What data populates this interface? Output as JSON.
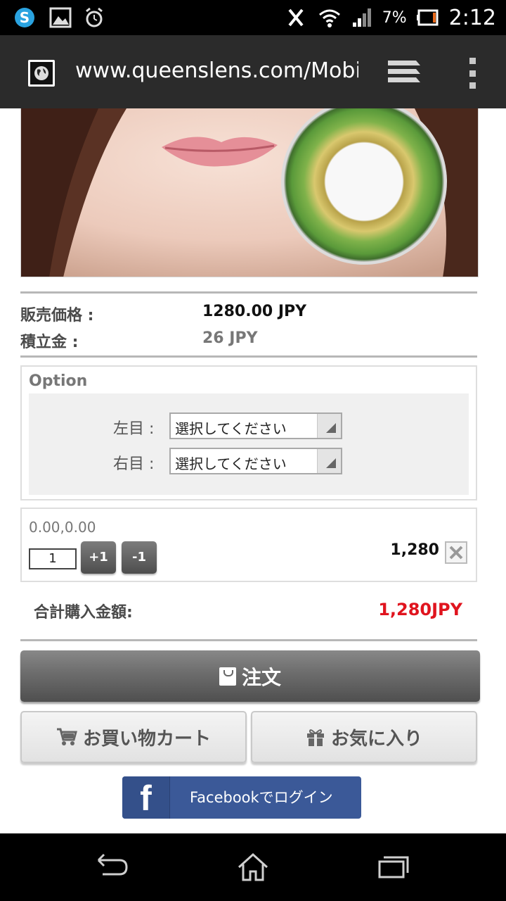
{
  "status_bar": {
    "left_icons": [
      "skype-icon",
      "gallery-icon",
      "alarm-icon"
    ],
    "right_icons": [
      "vibrate-icon",
      "wifi-icon",
      "signal-icon",
      "battery-icon"
    ],
    "battery_pct": "7%",
    "time": "2:12"
  },
  "browser": {
    "url": "www.queenslens.com/Mobile/",
    "favicon": "globe-icon",
    "tabs_icon": "tabs-icon",
    "menu_icon": "overflow-menu-icon"
  },
  "product": {
    "price_label": "販売価格 :",
    "price_value": "1280.00 JPY",
    "points_label": "積立金 :",
    "points_value": "26 JPY"
  },
  "option": {
    "title": "Option",
    "left_label": "左目 :",
    "left_value": "選択してください",
    "right_label": "右目 :",
    "right_value": "選択してください"
  },
  "quantity": {
    "selected_option": "0.00,0.00",
    "qty": "1",
    "plus_label": "+1",
    "minus_label": "-1",
    "line_price": "1,280"
  },
  "total": {
    "label": "合計購入金額:",
    "value": "1,280JPY"
  },
  "buttons": {
    "order": "注文",
    "cart": "お買い物カート",
    "wishlist": "お気に入り",
    "facebook_logo": "f",
    "facebook": "Facebookでログイン"
  },
  "colors": {
    "total_red": "#e0141e",
    "facebook_blue": "#3b5998"
  }
}
